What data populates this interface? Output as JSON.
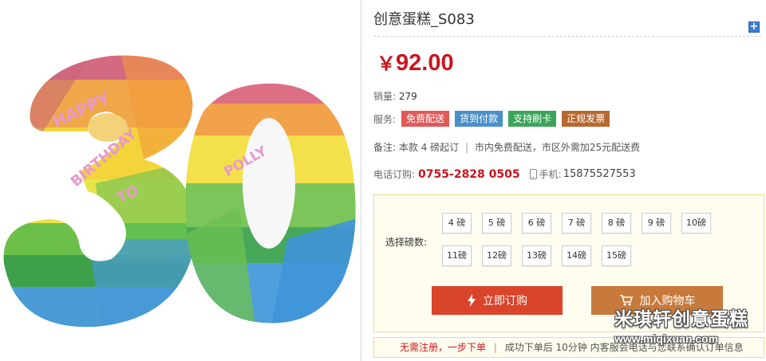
{
  "product": {
    "title": "创意蛋糕_S083",
    "price_symbol": "￥",
    "price_value": "92.00",
    "sales_label": "销量:",
    "sales_count": "279",
    "services_label": "服务:",
    "services": [
      {
        "label": "免费配送",
        "color": "#e05a5a"
      },
      {
        "label": "货到付款",
        "color": "#4a90c8"
      },
      {
        "label": "支持刷卡",
        "color": "#3aa55a"
      },
      {
        "label": "正规发票",
        "color": "#b8692f"
      }
    ],
    "note_label": "备注:",
    "note_part1": "本款 4 磅起订",
    "note_sep": "|",
    "note_part2": "市内免费配送，市区外需加25元配送费",
    "phone_label": "电话订购:",
    "phone": "0755-2828 0505",
    "mobile_label": "手机:",
    "mobile": "15875527553"
  },
  "image": {
    "cake_text_1": "HAPPY",
    "cake_text_2": "BIRTHDAY",
    "cake_text_3": "TO",
    "cake_text_4": "POLLY"
  },
  "weight_select": {
    "label": "选择磅数:",
    "options": [
      "4 磅",
      "5 磅",
      "6 磅",
      "7 磅",
      "8 磅",
      "9 磅",
      "10磅",
      "11磅",
      "12磅",
      "13磅",
      "14磅",
      "15磅"
    ]
  },
  "actions": {
    "order_label": "立即订购",
    "cart_label": "加入购物车"
  },
  "bottom_note": {
    "red_text": "无需注册，一步下单",
    "sep": "|",
    "text": "成功下单后 10分钟 内客服会电话与您联系确认订单信息"
  },
  "watermark": {
    "name": "米琪轩创意蛋糕",
    "url": "www.miqixuan.com"
  },
  "colors": {
    "price_red": "#c8161d",
    "order_button": "#d9442b",
    "cart_button": "#c77a3b",
    "select_bg": "#fffdf0"
  }
}
